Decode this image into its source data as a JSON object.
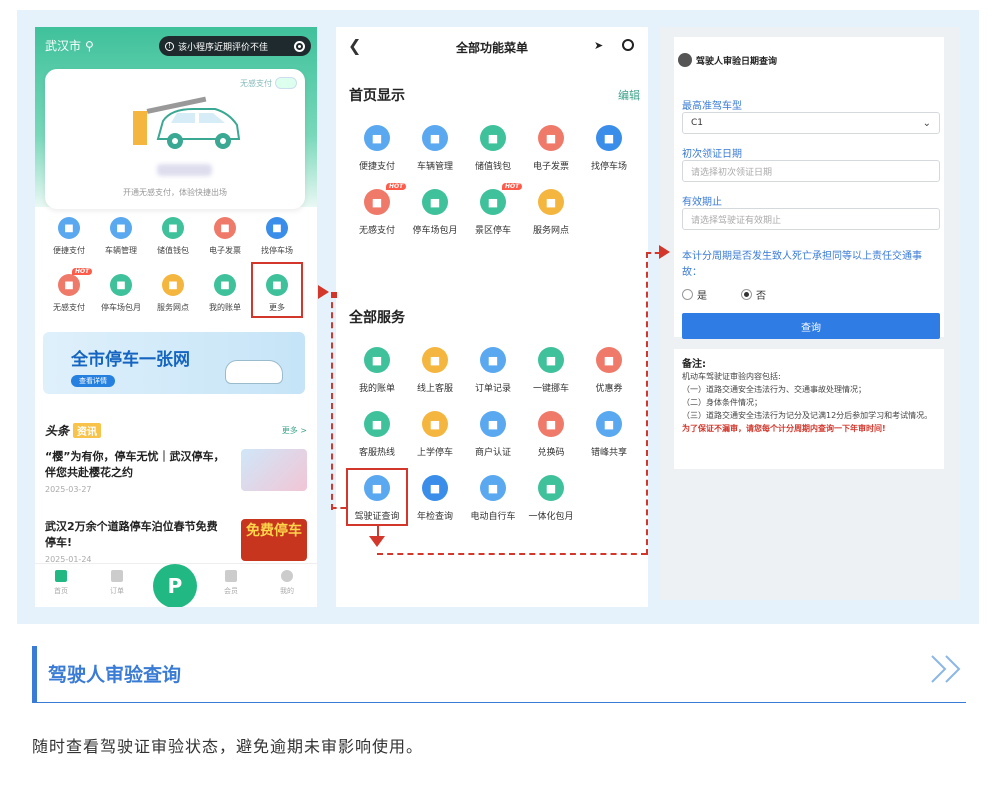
{
  "panel1": {
    "city": "武汉市",
    "notice": "该小程序近期评价不佳",
    "nonsense_pay": "无感支付",
    "card_sub": "开通无感支付，体验快捷出场",
    "icons": [
      {
        "label": "便捷支付",
        "color": "#5aa8f0",
        "icon": "wallet-icon"
      },
      {
        "label": "车辆管理",
        "color": "#5aa8f0",
        "icon": "car-icon"
      },
      {
        "label": "储值钱包",
        "color": "#3fc19b",
        "icon": "purse-icon"
      },
      {
        "label": "电子发票",
        "color": "#f07a6a",
        "icon": "invoice-icon"
      },
      {
        "label": "找停车场",
        "color": "#3a8de8",
        "icon": "parking-icon"
      },
      {
        "label": "无感支付",
        "color": "#f07a6a",
        "icon": "card-icon",
        "hot": "HOT"
      },
      {
        "label": "停车场包月",
        "color": "#3fc19b",
        "icon": "calendar-icon"
      },
      {
        "label": "服务网点",
        "color": "#f4b63f",
        "icon": "location-icon"
      },
      {
        "label": "我的账单",
        "color": "#3fc19b",
        "icon": "bill-icon"
      },
      {
        "label": "更多",
        "color": "#3fc19b",
        "icon": "more-icon"
      }
    ],
    "banner_title": "全市停车一张网",
    "banner_btn": "查看详情",
    "news_brand": "头条",
    "news_tag": "资讯",
    "news_more": "更多 >",
    "news": [
      {
        "title": "“樱”为有你，停车无忧｜武汉停车，伴您共赴樱花之约",
        "date": "2025-03-27"
      },
      {
        "title": "武汉2万余个道路停车泊位春节免费停车!",
        "date": "2025-01-24",
        "img_text": "免费停车"
      }
    ],
    "tabs": [
      "首页",
      "订单",
      "",
      "会员",
      "我的"
    ],
    "p_label": "P"
  },
  "panel2": {
    "title": "全部功能菜单",
    "section1": "首页显示",
    "edit": "编辑",
    "home_items": [
      {
        "label": "便捷支付",
        "color": "#5aa8f0",
        "icon": "wallet-icon"
      },
      {
        "label": "车辆管理",
        "color": "#5aa8f0",
        "icon": "car-icon"
      },
      {
        "label": "储值钱包",
        "color": "#3fc19b",
        "icon": "purse-icon"
      },
      {
        "label": "电子发票",
        "color": "#f07a6a",
        "icon": "invoice-icon"
      },
      {
        "label": "找停车场",
        "color": "#3a8de8",
        "icon": "parking-icon"
      },
      {
        "label": "无感支付",
        "color": "#f07a6a",
        "icon": "card-icon",
        "hot": "HOT"
      },
      {
        "label": "停车场包月",
        "color": "#3fc19b",
        "icon": "calendar-icon"
      },
      {
        "label": "景区停车",
        "color": "#3fc19b",
        "icon": "mountain-icon",
        "hot": "HOT"
      },
      {
        "label": "服务网点",
        "color": "#f4b63f",
        "icon": "location-icon"
      }
    ],
    "section2": "全部服务",
    "all_items": [
      {
        "label": "我的账单",
        "color": "#3fc19b",
        "icon": "bill-icon"
      },
      {
        "label": "线上客服",
        "color": "#f4b63f",
        "icon": "headset-icon"
      },
      {
        "label": "订单记录",
        "color": "#5aa8f0",
        "icon": "order-icon"
      },
      {
        "label": "一键挪车",
        "color": "#3fc19b",
        "icon": "car-move-icon"
      },
      {
        "label": "优惠券",
        "color": "#f07a6a",
        "icon": "coupon-icon"
      },
      {
        "label": "客服热线",
        "color": "#3fc19b",
        "icon": "phone-icon"
      },
      {
        "label": "上学停车",
        "color": "#f4b63f",
        "icon": "school-icon"
      },
      {
        "label": "商户认证",
        "color": "#5aa8f0",
        "icon": "shop-icon"
      },
      {
        "label": "兑换码",
        "color": "#f07a6a",
        "icon": "code-icon"
      },
      {
        "label": "错峰共享",
        "color": "#5aa8f0",
        "icon": "share-icon"
      },
      {
        "label": "驾驶证查询",
        "color": "#5aa8f0",
        "icon": "license-icon"
      },
      {
        "label": "年检查询",
        "color": "#3a8de8",
        "icon": "inspection-icon"
      },
      {
        "label": "电动自行车",
        "color": "#5aa8f0",
        "icon": "bike-icon"
      },
      {
        "label": "一体化包月",
        "color": "#3fc19b",
        "icon": "package-icon"
      }
    ]
  },
  "panel3": {
    "header": "驾驶人审验日期查询",
    "label_type": "最高准驾车型",
    "type_value": "C1",
    "label_first": "初次领证日期",
    "first_placeholder": "请选择初次领证日期",
    "label_valid": "有效期止",
    "valid_placeholder": "请选择驾驶证有效期止",
    "question": "本计分周期是否发生致人死亡承担同等以上责任交通事故：",
    "opt_yes": "是",
    "opt_no": "否",
    "query_btn": "查询",
    "notes_title": "备注:",
    "notes_intro": "机动车驾驶证审验内容包括:",
    "notes_lines": [
      "（一）道路交通安全违法行为、交通事故处理情况；",
      "（二）身体条件情况；",
      "（三）道路交通安全违法行为记分及记满12分后参加学习和考试情况。"
    ],
    "notes_warn": "为了保证不漏审，请您每个计分周期内查询一下年审时间!"
  },
  "section": {
    "title": "驾驶人审验查询",
    "desc": "随时查看驾驶证审验状态，避免逾期未审影响使用。"
  },
  "colors": {
    "accent": "#3a7bd5",
    "green": "#3fc19b",
    "highlight": "#d3372c"
  }
}
